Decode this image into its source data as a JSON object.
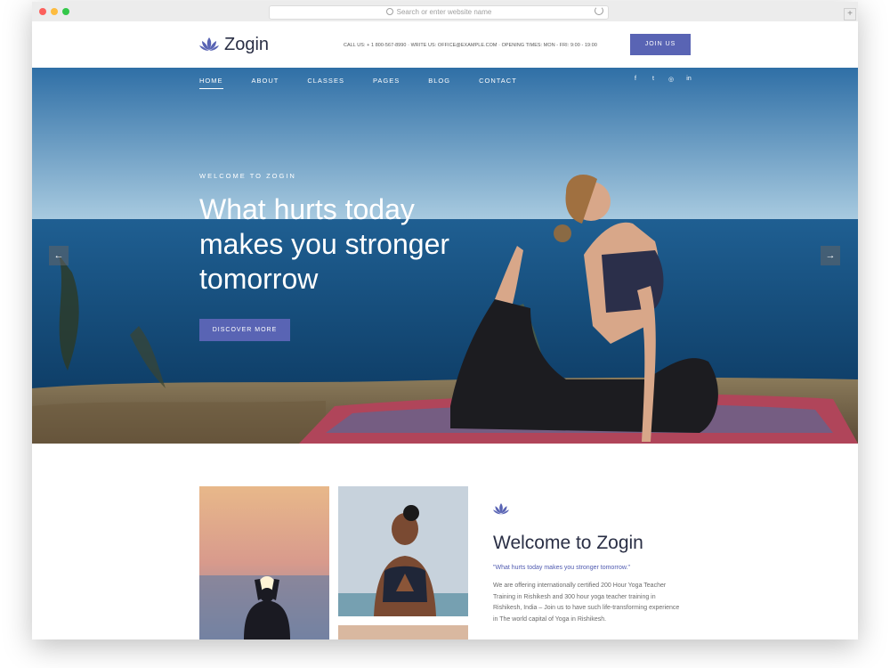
{
  "browser": {
    "url_placeholder": "Search or enter website name",
    "new_tab": "+"
  },
  "brand": {
    "name": "Zogin",
    "accent": "#5964b4",
    "dark": "#2a2f45"
  },
  "header": {
    "contact_line": "CALL US: + 1 800-567-8990 · WRITE US: OFFICE@EXAMPLE.COM · OPENING TIMES: MON - FRI: 9:00 - 19:00",
    "join_label": "JOIN US"
  },
  "nav": {
    "items": [
      {
        "label": "HOME",
        "active": true
      },
      {
        "label": "ABOUT",
        "active": false
      },
      {
        "label": "CLASSES",
        "active": false
      },
      {
        "label": "PAGES",
        "active": false
      },
      {
        "label": "BLOG",
        "active": false
      },
      {
        "label": "CONTACT",
        "active": false
      }
    ],
    "social": [
      {
        "icon": "facebook-icon",
        "glyph": "f"
      },
      {
        "icon": "twitter-icon",
        "glyph": "t"
      },
      {
        "icon": "instagram-icon",
        "glyph": "◎"
      },
      {
        "icon": "linkedin-icon",
        "glyph": "in"
      }
    ]
  },
  "hero": {
    "eyebrow": "WELCOME TO ZOGIN",
    "headline_line1": "What hurts today",
    "headline_line2": "makes you stronger",
    "headline_line3": "tomorrow",
    "cta_label": "DISCOVER MORE",
    "prev_glyph": "←",
    "next_glyph": "→"
  },
  "welcome": {
    "title": "Welcome to Zogin",
    "quote": "\"What hurts today makes you stronger tomorrow.\"",
    "body": "We are offering internationally certified 200 Hour Yoga Teacher Training in Rishikesh and 300 hour yoga teacher training in Rishikesh, India – Join us to have such life-transforming experience in The world capital of Yoga in Rishikesh."
  }
}
